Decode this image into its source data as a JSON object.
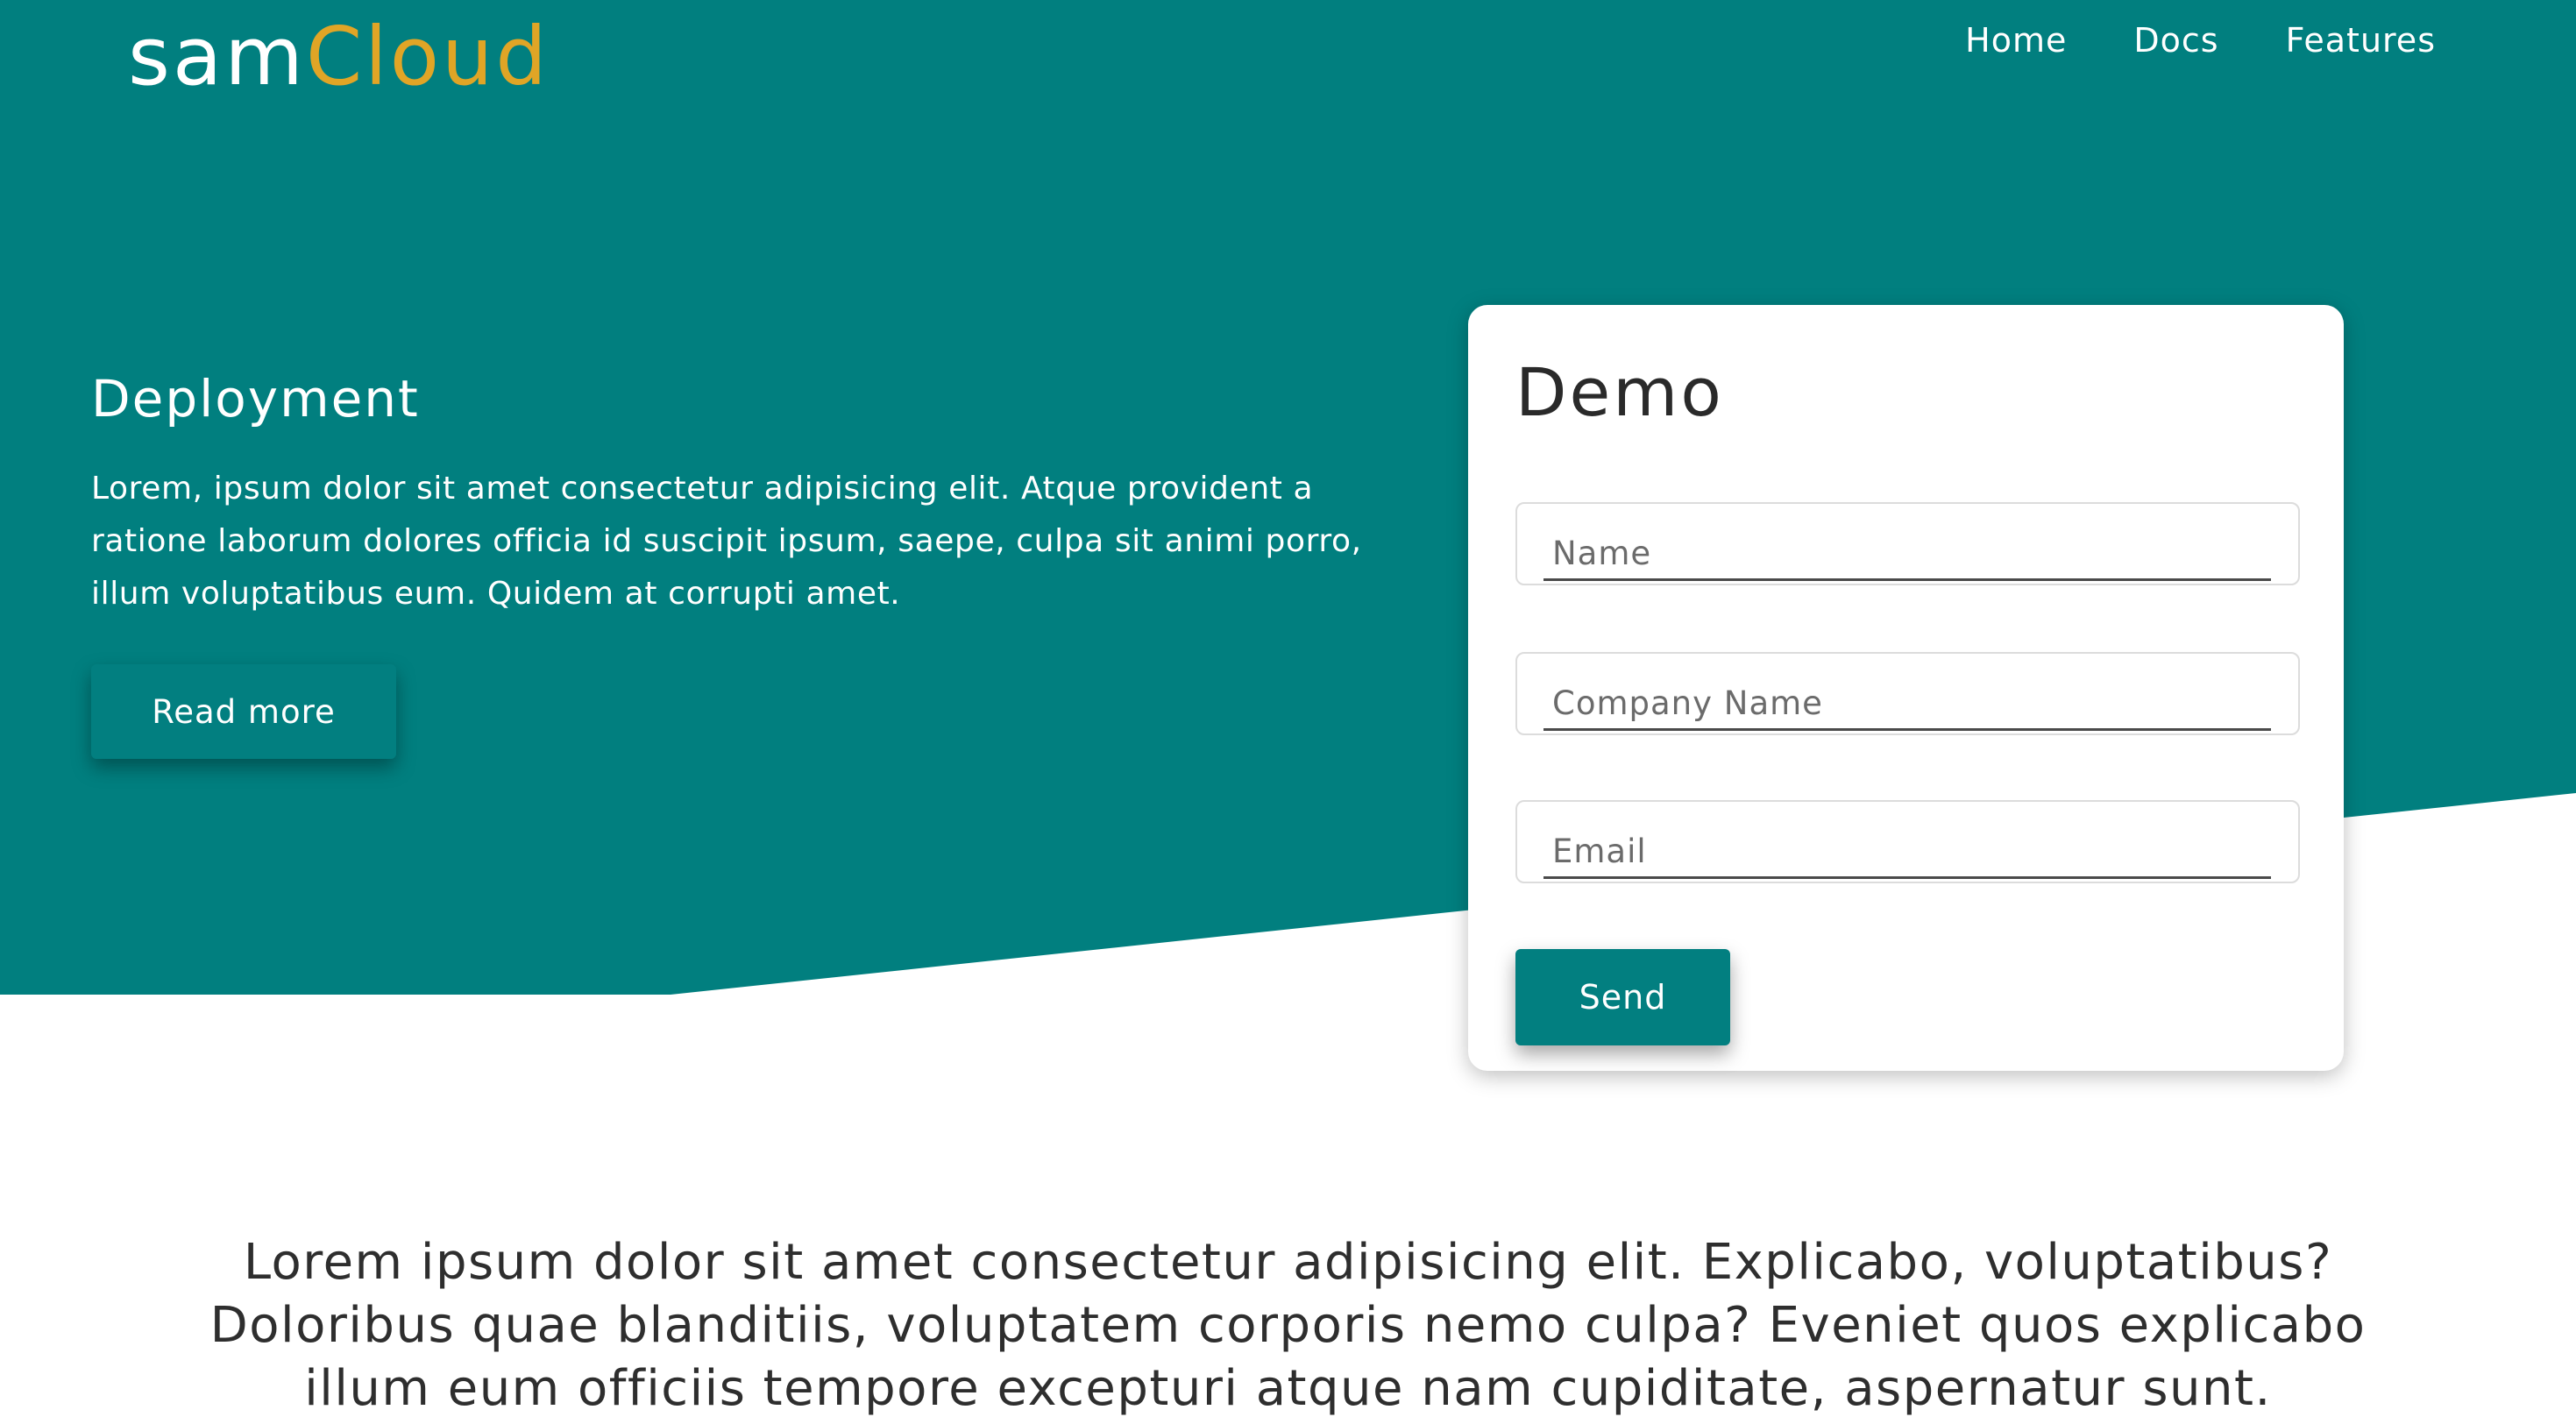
{
  "header": {
    "logo_primary": "sam",
    "logo_accent": "Cloud",
    "nav": [
      {
        "label": "Home"
      },
      {
        "label": "Docs"
      },
      {
        "label": "Features"
      }
    ]
  },
  "hero": {
    "title": "Deployment",
    "text": "Lorem, ipsum dolor sit amet consectetur adipisicing elit. Atque provident a ratione laborum dolores officia id suscipit ipsum, saepe, culpa sit animi porro, illum voluptatibus eum. Quidem at corrupti amet.",
    "button_label": "Read more"
  },
  "demo_form": {
    "title": "Demo",
    "fields": [
      {
        "placeholder": "Name",
        "value": ""
      },
      {
        "placeholder": "Company Name",
        "value": ""
      },
      {
        "placeholder": "Email",
        "value": ""
      }
    ],
    "submit_label": "Send"
  },
  "footer_text": "Lorem ipsum dolor sit amet consectetur adipisicing elit. Explicabo, voluptatibus? Doloribus quae blanditiis, voluptatem corporis nemo culpa? Eveniet quos explicabo illum eum officiis tempore excepturi atque nam cupiditate, aspernatur sunt.",
  "colors": {
    "hero_background": "#017f7f",
    "logo_accent": "#e0a526",
    "button": "#027f80",
    "text_dark": "#2e2e2e"
  }
}
